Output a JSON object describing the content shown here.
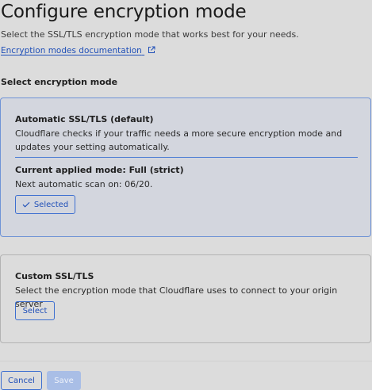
{
  "page": {
    "title": "Configure encryption mode",
    "subtitle": "Select the SSL/TLS encryption mode that works best for your needs.",
    "doc_link": "Encryption modes documentation",
    "section_heading": "Select encryption mode"
  },
  "automatic_card": {
    "title": "Automatic SSL/TLS (default)",
    "description": "Cloudflare checks if your traffic needs a more secure encryption mode and updates your setting automatically.",
    "applied_mode": "Current applied mode: Full (strict)",
    "next_scan": "Next automatic scan on: 06/20.",
    "button_label": "Selected",
    "state": "selected"
  },
  "custom_card": {
    "title": "Custom SSL/TLS",
    "description": "Select the encryption mode that Cloudflare uses to connect to your origin server",
    "button_label": "Select",
    "state": "unselected"
  },
  "footer": {
    "cancel_label": "Cancel",
    "save_label": "Save",
    "save_enabled": false
  },
  "icons": {
    "doc_link_icon": "external-link-icon",
    "selected_icon": "check-icon"
  },
  "colors": {
    "accent": "#1f4fb8",
    "selected_card_border": "#6f93d6",
    "save_disabled_bg": "#a9bee6"
  }
}
